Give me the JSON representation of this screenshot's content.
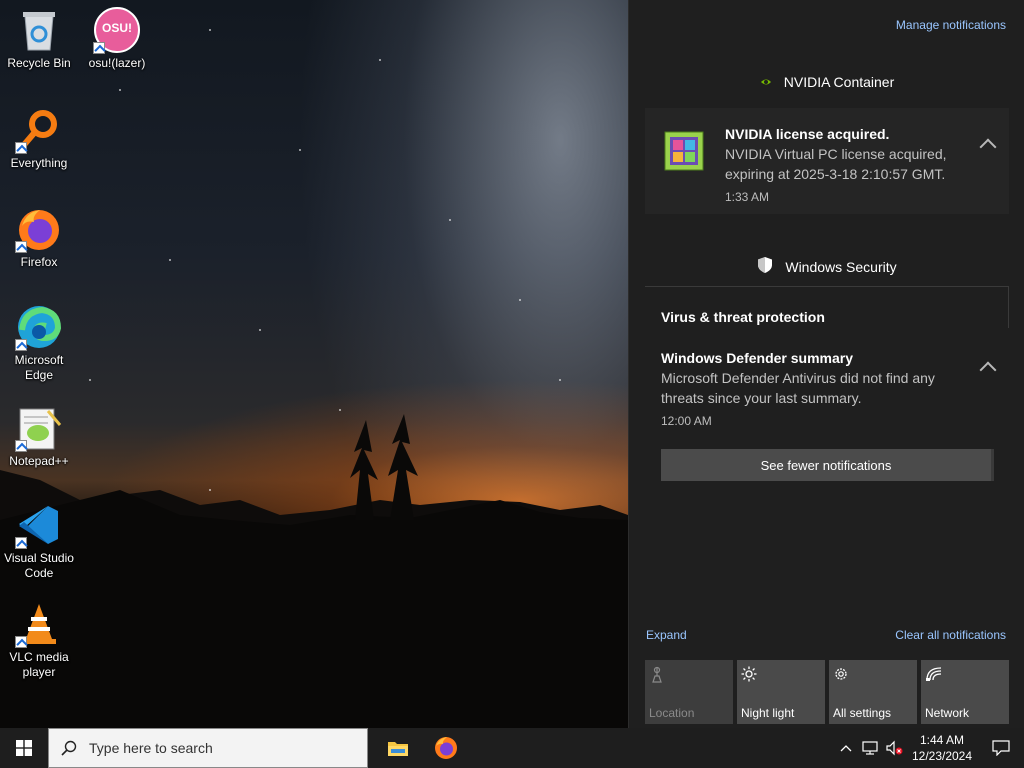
{
  "desktop_icons": [
    {
      "label": "Recycle Bin"
    },
    {
      "label": "osu!(lazer)",
      "logo_text": "OSU!"
    },
    {
      "label": "Everything"
    },
    {
      "label": "Firefox"
    },
    {
      "label": "Microsoft Edge"
    },
    {
      "label": "Notepad++"
    },
    {
      "label": "Visual Studio Code"
    },
    {
      "label": "VLC media player"
    }
  ],
  "action_center": {
    "manage_link": "Manage notifications",
    "groups": [
      {
        "app": "NVIDIA Container",
        "title": "NVIDIA license acquired.",
        "body": "NVIDIA Virtual PC license acquired, expiring at 2025-3-18 2:10:57 GMT.",
        "time": "1:33 AM"
      },
      {
        "app": "Windows Security",
        "subheader": "Virus & threat protection",
        "title": "Windows Defender summary",
        "body": "Microsoft Defender Antivirus did not find any threats since your last summary.",
        "time": "12:00 AM"
      }
    ],
    "see_fewer": "See fewer notifications",
    "expand": "Expand",
    "clear_all": "Clear all notifications",
    "quick_actions": [
      {
        "label": "Location",
        "icon": "location-icon",
        "enabled": false
      },
      {
        "label": "Night light",
        "icon": "night-light-icon",
        "enabled": true
      },
      {
        "label": "All settings",
        "icon": "gear-icon",
        "enabled": true
      },
      {
        "label": "Network",
        "icon": "network-icon",
        "enabled": true
      }
    ]
  },
  "taskbar": {
    "search_placeholder": "Type here to search",
    "pinned": [
      "file-explorer-icon",
      "firefox-icon"
    ],
    "clock_time": "1:44 AM",
    "clock_date": "12/23/2024"
  },
  "colors": {
    "accent_link": "#9ac6ff",
    "panel_bg": "#1f1f1f",
    "taskbar_bg": "#1e1e1e"
  }
}
